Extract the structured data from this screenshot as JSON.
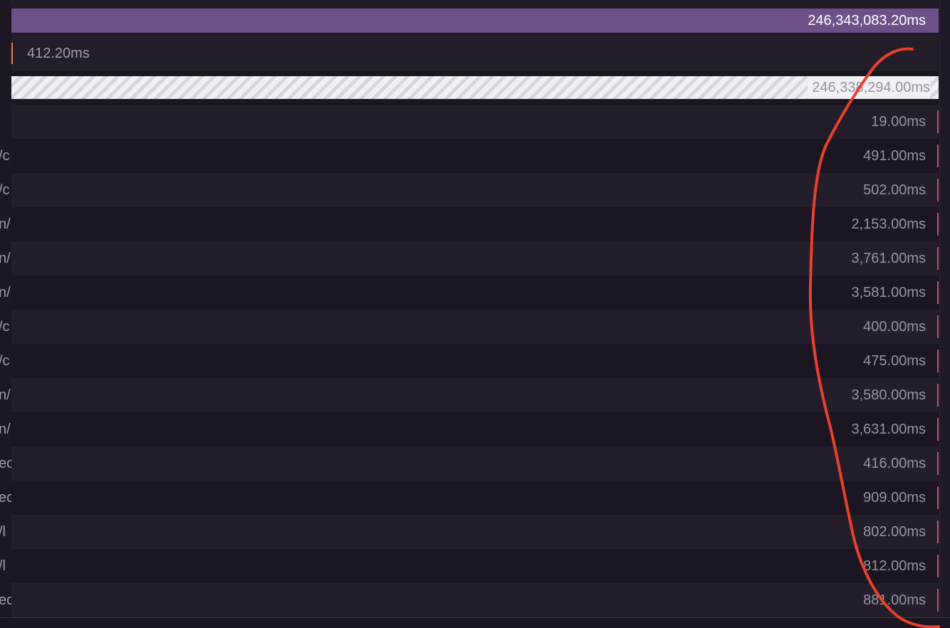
{
  "total": {
    "duration": "246,343,083.20ms"
  },
  "first_span": {
    "duration": "412.20ms"
  },
  "gap": {
    "duration": "246,338,294.00ms"
  },
  "rows": [
    {
      "name": "",
      "duration": "19.00ms"
    },
    {
      "name": "/c",
      "duration": "491.00ms"
    },
    {
      "name": "/c",
      "duration": "502.00ms"
    },
    {
      "name": "n/",
      "duration": "2,153.00ms"
    },
    {
      "name": "n/",
      "duration": "3,761.00ms"
    },
    {
      "name": "n/",
      "duration": "3,581.00ms"
    },
    {
      "name": "/c",
      "duration": "400.00ms"
    },
    {
      "name": "/c",
      "duration": "475.00ms"
    },
    {
      "name": "n/",
      "duration": "3,580.00ms"
    },
    {
      "name": "n/",
      "duration": "3,631.00ms"
    },
    {
      "name": "ec",
      "duration": "416.00ms"
    },
    {
      "name": "ec",
      "duration": "909.00ms"
    },
    {
      "name": "/l",
      "duration": "802.00ms"
    },
    {
      "name": "/l",
      "duration": "812.00ms"
    },
    {
      "name": "ec",
      "duration": "881.00ms"
    }
  ],
  "colors": {
    "total_bar": "#6e5088",
    "first_marker": "#e0863d",
    "row_tick": "#b4577a",
    "annotation": "#e8412c"
  }
}
